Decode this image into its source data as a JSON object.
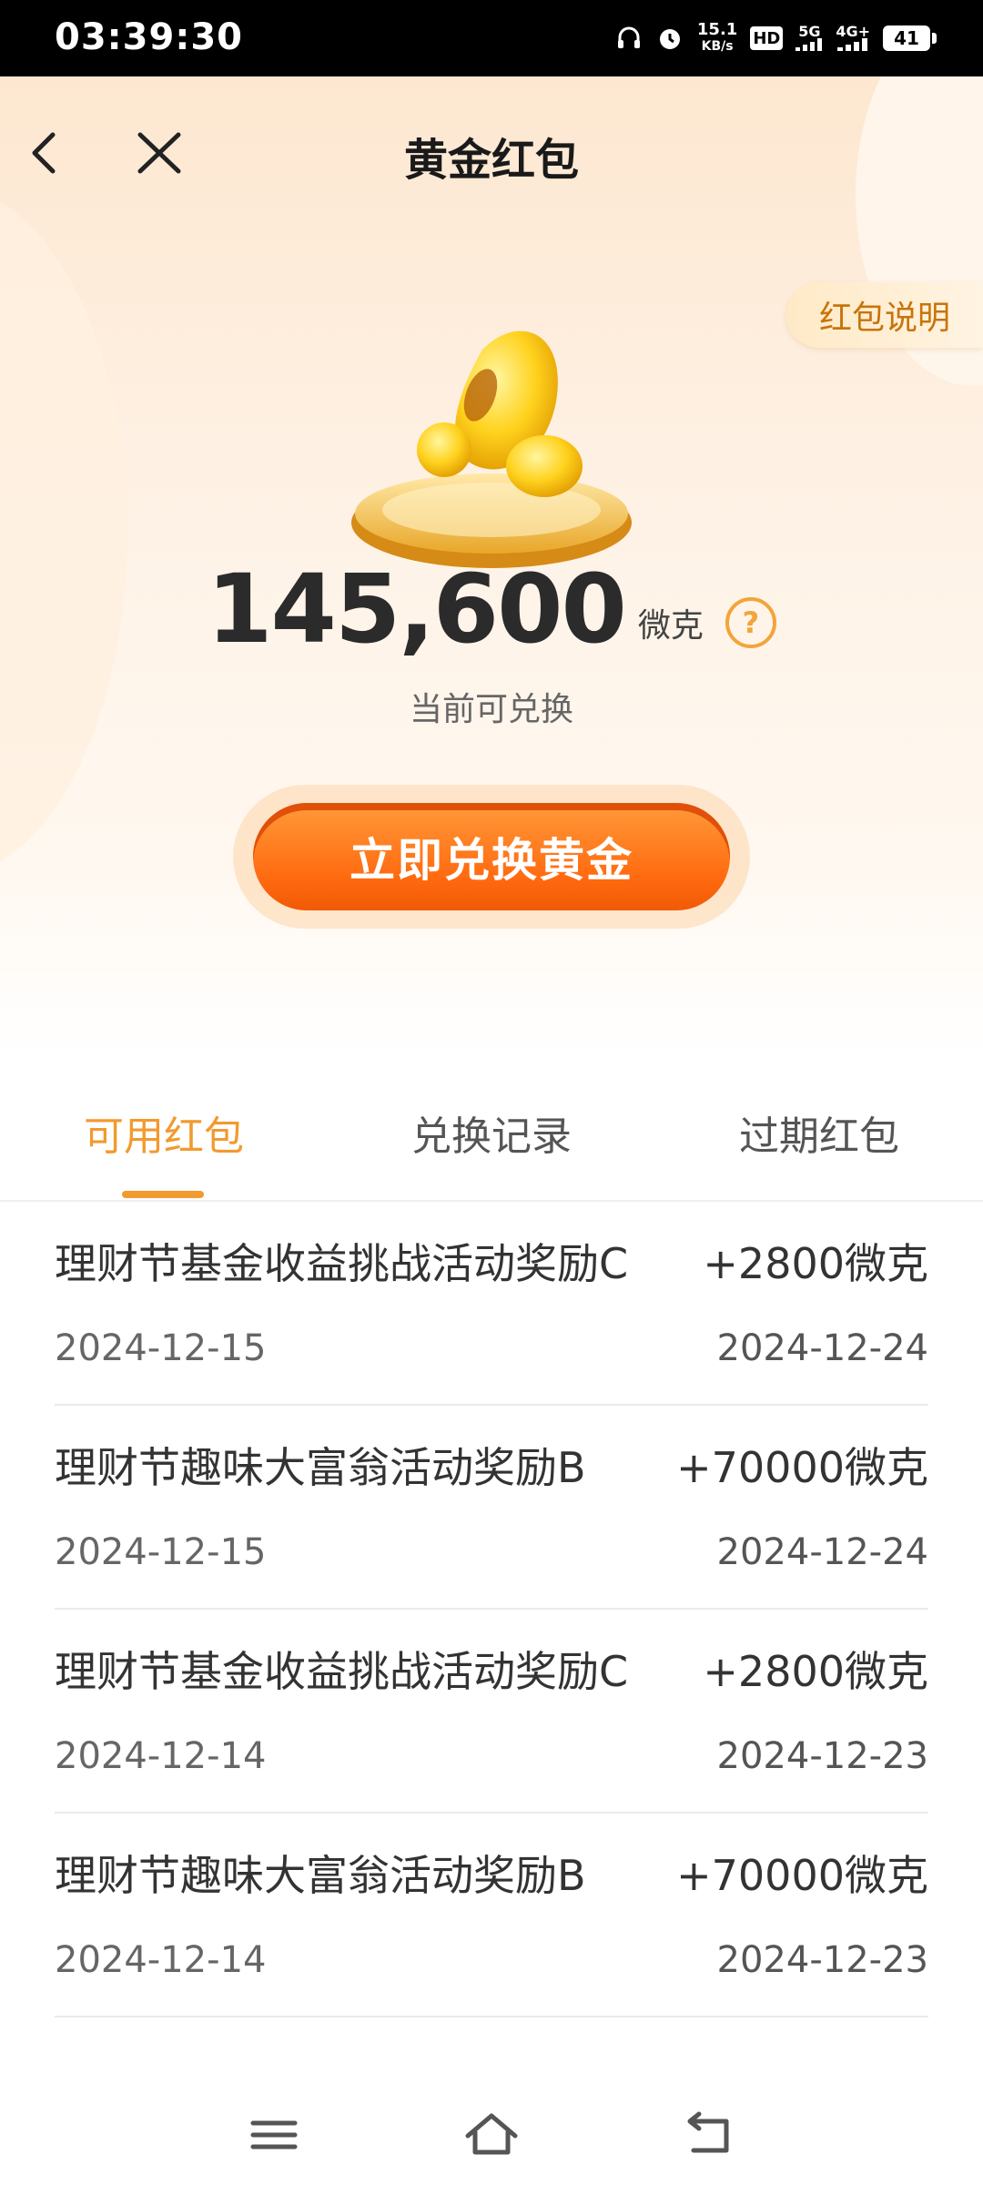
{
  "status_bar": {
    "time": "03:39:30",
    "net_speed_value": "15.1",
    "net_speed_unit": "KB/s",
    "hd_label": "HD",
    "sim2": "5G",
    "sim1": "4G+",
    "battery": "41",
    "icons": [
      "headphones-icon",
      "alarm-icon",
      "hd-icon",
      "signal-5g-icon",
      "signal-4g-icon",
      "battery-icon"
    ]
  },
  "header": {
    "title": "黄金红包",
    "back_icon": "back-arrow-icon",
    "close_icon": "close-icon",
    "rule_label": "红包说明"
  },
  "balance": {
    "amount": "145,600",
    "unit": "微克",
    "help_glyph": "?",
    "sub_label": "当前可兑换"
  },
  "exchange_button": {
    "label": "立即兑换黄金"
  },
  "tabs": [
    {
      "label": "可用红包",
      "active": true
    },
    {
      "label": "兑换记录",
      "active": false
    },
    {
      "label": "过期红包",
      "active": false
    }
  ],
  "list": [
    {
      "title": "理财节基金收益挑战活动奖励C",
      "amount": "+2800微克",
      "issue_date": "2024-12-15",
      "expire_date": "2024-12-24"
    },
    {
      "title": "理财节趣味大富翁活动奖励B",
      "amount": "+70000微克",
      "issue_date": "2024-12-15",
      "expire_date": "2024-12-24"
    },
    {
      "title": "理财节基金收益挑战活动奖励C",
      "amount": "+2800微克",
      "issue_date": "2024-12-14",
      "expire_date": "2024-12-23"
    },
    {
      "title": "理财节趣味大富翁活动奖励B",
      "amount": "+70000微克",
      "issue_date": "2024-12-14",
      "expire_date": "2024-12-23"
    }
  ],
  "nav_bar": {
    "icons": [
      "menu-icon",
      "home-icon",
      "back-icon"
    ]
  },
  "colors": {
    "accent": "#f29a2e",
    "button_orange": "#ff6a10",
    "hero_bg": "#fde7d0",
    "rule_text": "#c8740a"
  }
}
